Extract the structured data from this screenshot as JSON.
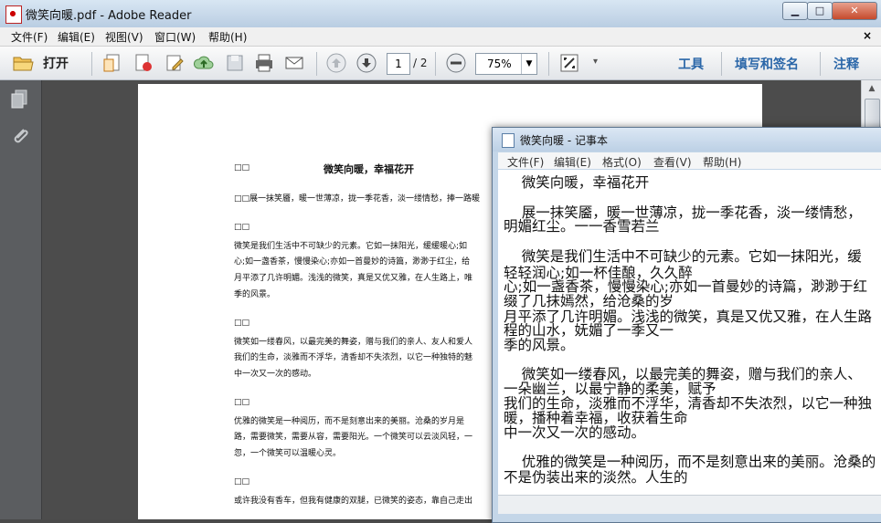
{
  "window": {
    "title": "微笑向暖.pdf - Adobe Reader",
    "minimize_label": "▁",
    "maximize_label": "□",
    "close_label": "✕"
  },
  "menu": {
    "items": [
      "文件(F)",
      "编辑(E)",
      "视图(V)",
      "窗口(W)",
      "帮助(H)"
    ],
    "close_label": "×"
  },
  "toolbar": {
    "open_label": "打开",
    "page_current": "1",
    "page_total": "/ 2",
    "zoom": "75%",
    "right_tabs": [
      "工具",
      "填写和签名",
      "注释"
    ]
  },
  "pdf": {
    "title_prefix": "□□",
    "title": "微笑向暖，幸福花开",
    "lines": [
      "□□展一抹笑靥，暖一世薄凉，拢一季花香，淡一缕情愁，捧一路暖",
      "□□",
      "微笑是我们生活中不可缺少的元素。它如一抹阳光，缓缓暖心;如",
      "心;如一盏香茶，慢慢染心;亦如一首曼妙的诗篇，渺渺于红尘，给",
      "月平添了几许明媚。浅浅的微笑，真是又优又雅，在人生路上，唯",
      "季的风景。",
      "□□",
      "微笑如一缕春风，以最完美的舞姿，赠与我们的亲人、友人和爱人",
      "我们的生命，淡雅而不浮华，清香却不失浓烈，以它一种独特的魅",
      "中一次又一次的感动。",
      "□□",
      "优雅的微笑是一种阅历，而不是刻意出来的美丽。沧桑的岁月是",
      "路，需要微笑，需要从容，需要阳光。一个微笑可以云淡风轻，一",
      "忽，一个微笑可以温暖心灵。",
      "□□",
      "或许我没有香车，但我有健康的双腿，已微笑的姿态，靠自己走出"
    ]
  },
  "notepad": {
    "title": "微笑向暖 - 记事本",
    "menu": [
      "文件(F)",
      "编辑(E)",
      "格式(O)",
      "查看(V)",
      "帮助(H)"
    ],
    "lines": [
      "    微笑向暖，幸福花开",
      "",
      "    展一抹笑靥，暖一世薄凉，拢一季花香，淡一缕情愁，",
      "明媚红尘。一一香雪若兰",
      "",
      "    微笑是我们生活中不可缺少的元素。它如一抹阳光，缓",
      "轻轻润心;如一杯佳酿，久久醉",
      "心;如一盏香茶，慢慢染心;亦如一首曼妙的诗篇，渺渺于红",
      "缀了几抹嫣然，给沧桑的岁",
      "月平添了几许明媚。浅浅的微笑，真是又优又雅，在人生路",
      "程的山水，妩媚了一季又一",
      "季的风景。",
      "",
      "    微笑如一缕春风，以最完美的舞姿，赠与我们的亲人、",
      "一朵幽兰，以最宁静的柔美，赋予",
      "我们的生命，淡雅而不浮华，清香却不失浓烈，以它一种独",
      "暖，播种着幸福，收获着生命",
      "中一次又一次的感动。",
      "",
      "    优雅的微笑是一种阅历，而不是刻意出来的美丽。沧桑的",
      "不是伪装出来的淡然。人生的"
    ]
  },
  "icon_names": [
    "open-folder-icon",
    "create-pdf-icon",
    "export-pdf-icon",
    "edit-icon",
    "upload-icon",
    "save-icon",
    "print-icon",
    "email-icon",
    "prev-page-icon",
    "next-page-icon",
    "zoom-out-icon",
    "fit-page-icon",
    "more-icon",
    "pages-panel-icon",
    "attachments-icon",
    "notepad-icon",
    "pdf-app-icon"
  ]
}
